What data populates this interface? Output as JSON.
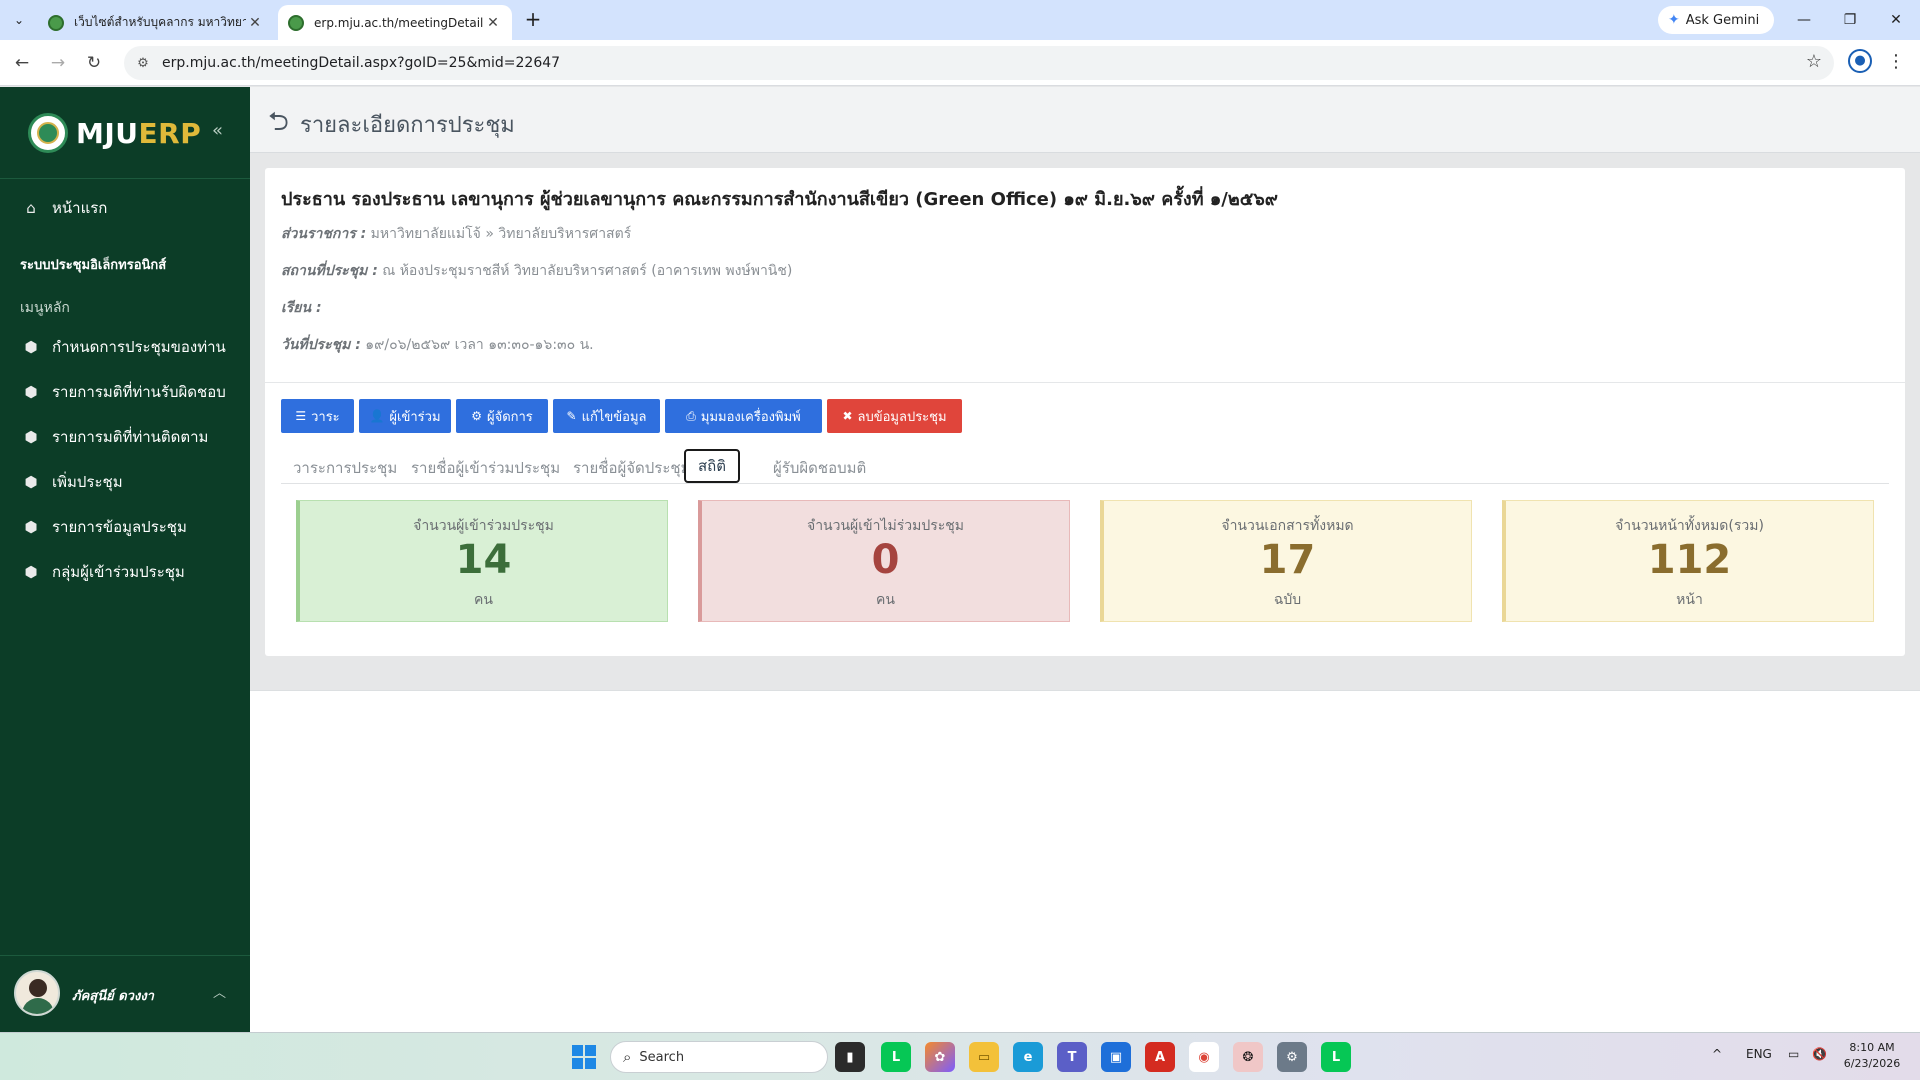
{
  "browser": {
    "tabs": [
      {
        "title": "เว็บไซต์สำหรับบุคลากร มหาวิทยาลัยแม่โจ้",
        "active": false
      },
      {
        "title": "erp.mju.ac.th/meetingDetail.aspx",
        "active": true
      }
    ],
    "url": "erp.mju.ac.th/meetingDetail.aspx?goID=25&mid=22647",
    "gemini_label": "Ask Gemini"
  },
  "sidebar": {
    "brand_white": "MJU",
    "brand_yellow": "ERP",
    "home_label": "หน้าแรก",
    "system_heading": "ระบบประชุมอิเล็กทรอนิกส์",
    "menu_heading": "เมนูหลัก",
    "items": [
      {
        "label": "กำหนดการประชุมของท่าน"
      },
      {
        "label": "รายการมติที่ท่านรับผิดชอบ"
      },
      {
        "label": "รายการมติที่ท่านติดตาม"
      },
      {
        "label": "เพิ่มประชุม"
      },
      {
        "label": "รายการข้อมูลประชุม"
      },
      {
        "label": "กลุ่มผู้เข้าร่วมประชุม"
      }
    ],
    "user_name": "ภัคสุนีย์ ดวงงา"
  },
  "page": {
    "title": "รายละเอียดการประชุม"
  },
  "meeting": {
    "title": "ประธาน รองประธาน เลขานุการ ผู้ช่วยเลขานุการ คณะกรรมการสำนักงานสีเขียว (Green Office) ๑๙ มิ.ย.๖๙  ครั้งที่ ๑/๒๕๖๙",
    "agency_label": "ส่วนราชการ :",
    "agency_value": "มหาวิทยาลัยแม่โจ้ » วิทยาลัยบริหารศาสตร์",
    "venue_label": "สถานที่ประชุม :",
    "venue_value": "ณ ห้องประชุมราชสีห์ วิทยาลัยบริหารศาสตร์ (อาคารเทพ พงษ์พานิช)",
    "attn_label": "เรียน :",
    "attn_value": "",
    "date_label": "วันที่ประชุม :",
    "date_value": "๑๙/๐๖/๒๕๖๙ เวลา ๑๓:๓๐-๑๖:๓๐ น."
  },
  "actions": {
    "agenda": "วาระ",
    "attendees": "ผู้เข้าร่วม",
    "managers": "ผู้จัดการ",
    "edit": "แก้ไขข้อมูล",
    "print": "มุมมองเครื่องพิมพ์",
    "delete": "ลบข้อมูลประชุม"
  },
  "tabs": [
    {
      "label": "วาระการประชุม"
    },
    {
      "label": "รายชื่อผู้เข้าร่วมประชุม"
    },
    {
      "label": "รายชื่อผู้จัดประชุม"
    },
    {
      "label": "สถิติ",
      "active": true
    },
    {
      "label": "ผู้รับผิดชอบมติ"
    }
  ],
  "stats": [
    {
      "label": "จำนวนผู้เข้าร่วมประชุม",
      "value": "14",
      "unit": "คน",
      "color": "#3c6e3a"
    },
    {
      "label": "จำนวนผู้เข้าไม่ร่วมประชุม",
      "value": "0",
      "unit": "คน",
      "color": "#a5443f"
    },
    {
      "label": "จำนวนเอกสารทั้งหมด",
      "value": "17",
      "unit": "ฉบับ",
      "color": "#8a6d2e"
    },
    {
      "label": "จำนวนหน้าทั้งหมด(รวม)",
      "value": "112",
      "unit": "หน้า",
      "color": "#8a6d2e"
    }
  ],
  "taskbar": {
    "search_placeholder": "Search",
    "lang": "ENG",
    "time": "8:10 AM",
    "date": "6/23/2026"
  }
}
